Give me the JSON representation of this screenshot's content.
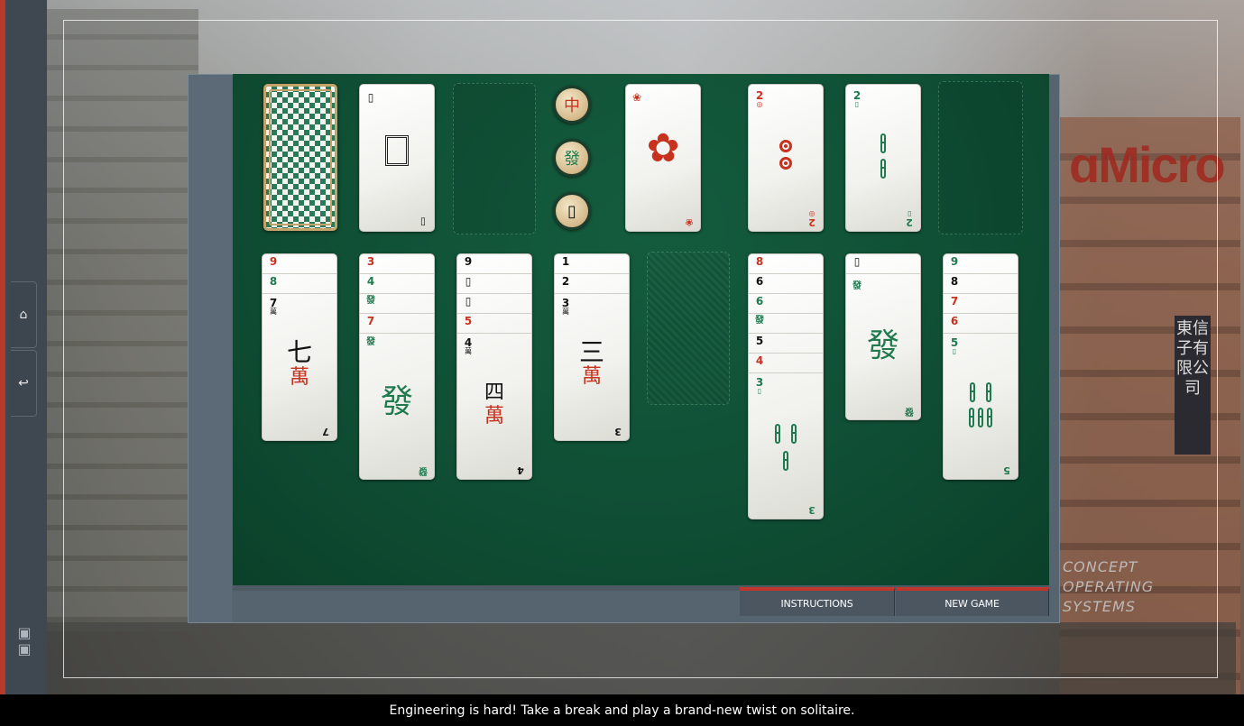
{
  "background": {
    "sign_text": "ɑMicro",
    "chinese_sign": "東信子有限公司",
    "concept_lines": [
      "CONCEPT",
      "OPERATING",
      "SYSTEMS"
    ]
  },
  "rail": {
    "home_icon": "home-icon",
    "back_icon": "undo-icon",
    "logo": "cs-logo"
  },
  "game": {
    "buttons": {
      "instructions": "INSTRUCTIONS",
      "new_game": "NEW GAME"
    },
    "top_row": {
      "waste_card": {
        "rank": "▯",
        "face": "▯"
      },
      "dragons": [
        "中",
        "發",
        "▯"
      ],
      "flower": {
        "corner": "❀",
        "face": "✿"
      },
      "foundation_1": {
        "rank": "2",
        "suit": "coins"
      },
      "foundation_2": {
        "rank": "2",
        "suit": "bamboo"
      }
    },
    "tableau": [
      {
        "strips": [
          {
            "r": "9",
            "c": "red"
          },
          {
            "r": "8",
            "c": "green"
          }
        ],
        "top": {
          "rank": "7",
          "sub": "萬",
          "color": "black",
          "face1": "七",
          "face2": "萬"
        }
      },
      {
        "strips": [
          {
            "r": "3",
            "c": "red"
          },
          {
            "r": "4",
            "c": "green"
          },
          {
            "r": "發",
            "c": "green"
          },
          {
            "r": "7",
            "c": "red"
          }
        ],
        "top": {
          "rank": "發",
          "sub": "",
          "color": "green",
          "face1": "發",
          "face2": ""
        }
      },
      {
        "strips": [
          {
            "r": "9",
            "c": "black"
          },
          {
            "r": "▯",
            "c": "black"
          },
          {
            "r": "▯",
            "c": "black"
          },
          {
            "r": "5",
            "c": "red"
          }
        ],
        "top": {
          "rank": "4",
          "sub": "萬",
          "color": "black",
          "face1": "四",
          "face2": "萬"
        }
      },
      {
        "strips": [
          {
            "r": "1",
            "c": "black"
          },
          {
            "r": "2",
            "c": "black"
          }
        ],
        "top": {
          "rank": "3",
          "sub": "萬",
          "color": "black",
          "face1": "三",
          "face2": "萬"
        }
      },
      {
        "strips": [],
        "top": null
      },
      {
        "strips": [
          {
            "r": "8",
            "c": "red"
          },
          {
            "r": "6",
            "c": "black"
          },
          {
            "r": "6",
            "c": "green"
          },
          {
            "r": "發",
            "c": "green"
          },
          {
            "r": "5",
            "c": "black"
          },
          {
            "r": "4",
            "c": "red"
          }
        ],
        "top": {
          "rank": "3",
          "sub": "▯",
          "color": "green",
          "face1": "bamboo3",
          "face2": ""
        }
      },
      {
        "strips": [
          {
            "r": "▯",
            "c": "black"
          }
        ],
        "top": {
          "rank": "發",
          "sub": "",
          "color": "green",
          "face1": "發",
          "face2": ""
        }
      },
      {
        "strips": [
          {
            "r": "9",
            "c": "green"
          },
          {
            "r": "8",
            "c": "black"
          },
          {
            "r": "7",
            "c": "red"
          },
          {
            "r": "6",
            "c": "red"
          }
        ],
        "top": {
          "rank": "5",
          "sub": "▯",
          "color": "green",
          "face1": "bamboo5",
          "face2": ""
        }
      }
    ]
  },
  "caption": "Engineering is hard! Take a break and play a brand-new twist on solitaire."
}
